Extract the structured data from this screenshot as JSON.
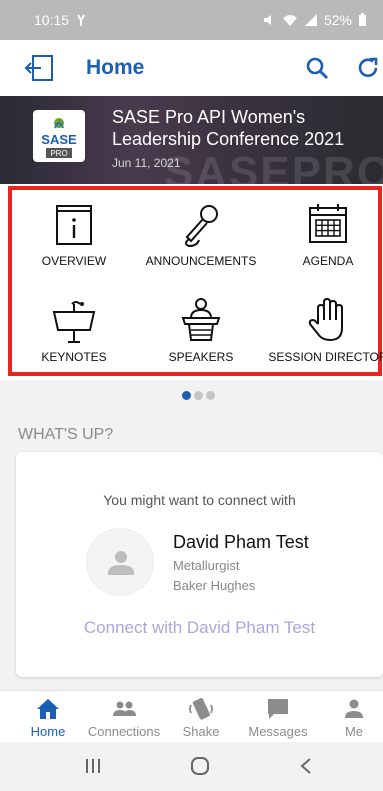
{
  "status": {
    "time": "10:15",
    "battery": "52%"
  },
  "appbar": {
    "title": "Home"
  },
  "event": {
    "title": "SASE Pro API Women's Leadership Conference 2021",
    "date": "Jun 11, 2021",
    "logo_text": "SASE",
    "logo_sub": "PRO",
    "bg_text": "SASEPRO"
  },
  "tiles": [
    {
      "label": "OVERVIEW",
      "icon": "info-icon"
    },
    {
      "label": "ANNOUNCEMENTS",
      "icon": "microphone-icon"
    },
    {
      "label": "AGENDA",
      "icon": "calendar-icon"
    },
    {
      "label": "KEYNOTES",
      "icon": "lectern-icon"
    },
    {
      "label": "SPEAKERS",
      "icon": "speaker-podium-icon"
    },
    {
      "label": "SESSION DIRECTOR",
      "icon": "hand-icon"
    }
  ],
  "section": {
    "title": "WHAT'S UP?"
  },
  "card": {
    "prompt": "You might want to connect with",
    "name": "David Pham Test",
    "role": "Metallurgist",
    "company": "Baker Hughes",
    "connect_label": "Connect with David Pham Test"
  },
  "bottom_nav": [
    {
      "label": "Home",
      "icon": "home-icon",
      "active": true
    },
    {
      "label": "Connections",
      "icon": "people-icon",
      "active": false
    },
    {
      "label": "Shake",
      "icon": "shake-phone-icon",
      "active": false
    },
    {
      "label": "Messages",
      "icon": "message-icon",
      "active": false
    },
    {
      "label": "Me",
      "icon": "person-icon",
      "active": false
    }
  ],
  "colors": {
    "accent": "#1a5fb4",
    "highlight": "#e8261f",
    "connect": "#a9a6dd"
  }
}
